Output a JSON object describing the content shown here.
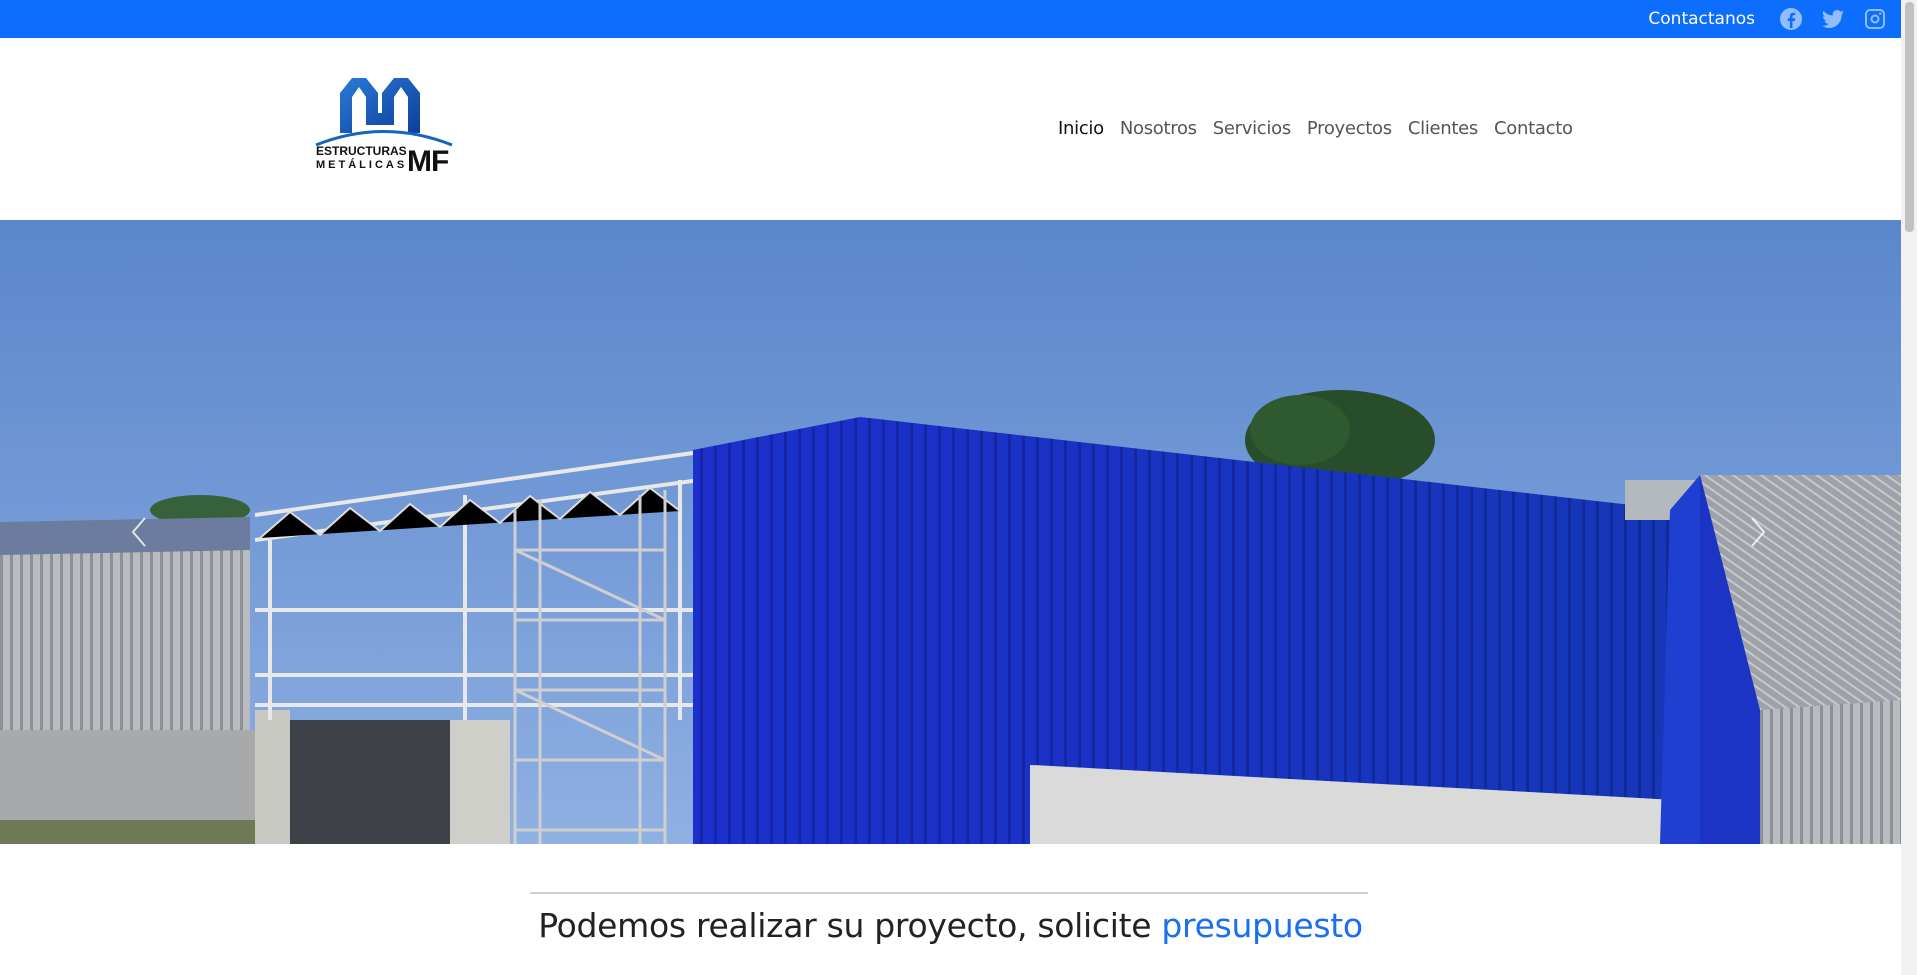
{
  "topbar": {
    "contact_label": "Contactanos",
    "icons": [
      "facebook-icon",
      "twitter-icon",
      "instagram-icon"
    ],
    "color": "#0d6efd"
  },
  "logo": {
    "line1": "ESTRUCTURAS",
    "line2": "METÁLICAS",
    "brand": "MF",
    "color": "#1565c0"
  },
  "nav": {
    "items": [
      {
        "label": "Inicio",
        "active": true
      },
      {
        "label": "Nosotros",
        "active": false
      },
      {
        "label": "Servicios",
        "active": false
      },
      {
        "label": "Proyectos",
        "active": false
      },
      {
        "label": "Clientes",
        "active": false
      },
      {
        "label": "Contacto",
        "active": false
      }
    ]
  },
  "carousel": {
    "prev_icon": "chevron-left-icon",
    "next_icon": "chevron-right-icon"
  },
  "cta": {
    "text": "Podemos realizar su proyecto, solicite ",
    "highlight": "presupuesto",
    "highlight_color": "#1a6ef0"
  }
}
